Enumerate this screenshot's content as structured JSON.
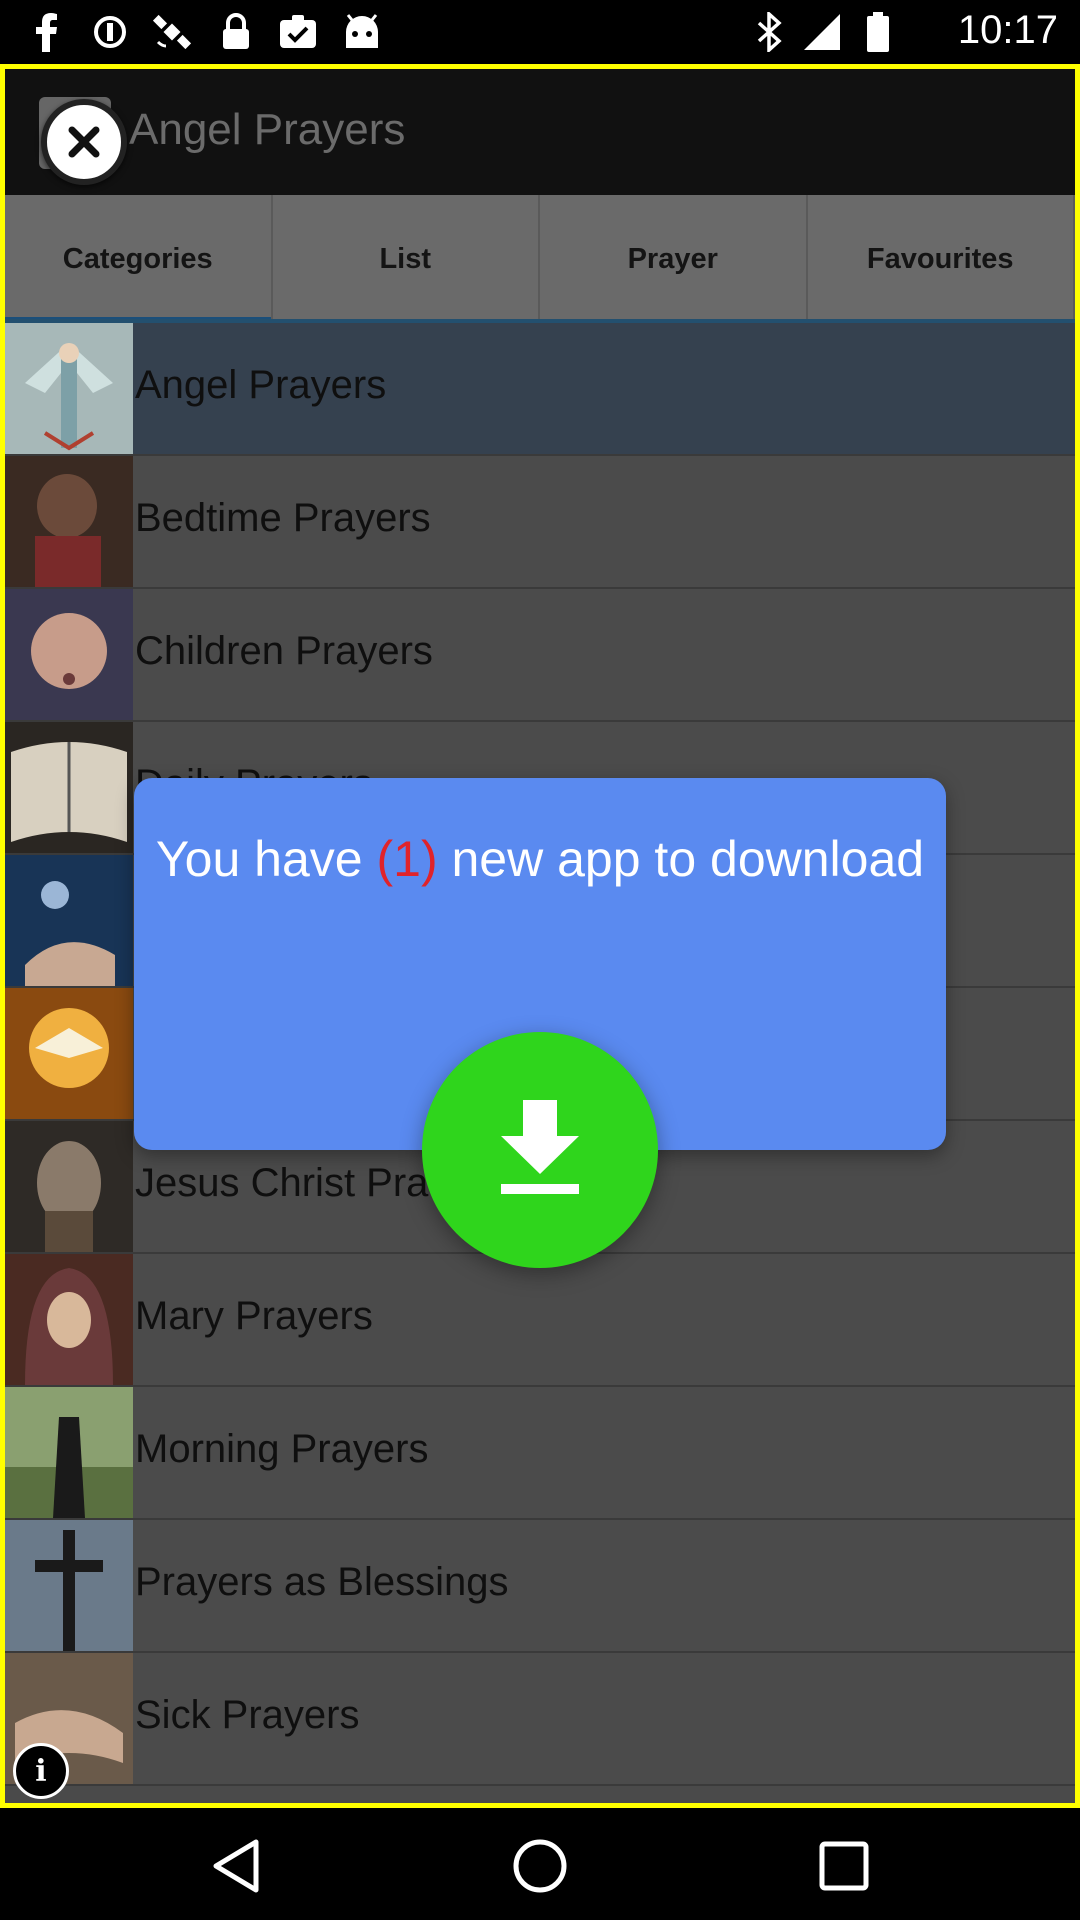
{
  "status_bar": {
    "time": "10:17",
    "left_icons": [
      "facebook-icon",
      "data-saver-icon",
      "fake-gps-icon",
      "lock-icon",
      "clipboard-check-icon",
      "android-icon"
    ],
    "right_icons": [
      "bluetooth-icon",
      "signal-icon",
      "battery-icon"
    ]
  },
  "app": {
    "title": "Angel Prayers"
  },
  "tabs": [
    {
      "label": "Categories",
      "active": true
    },
    {
      "label": "List",
      "active": false
    },
    {
      "label": "Prayer",
      "active": false
    },
    {
      "label": "Favourites",
      "active": false
    }
  ],
  "list": {
    "items": [
      {
        "label": "Angel Prayers",
        "selected": true
      },
      {
        "label": "Bedtime Prayers"
      },
      {
        "label": "Children Prayers"
      },
      {
        "label": "Daily Prayers"
      },
      {
        "label": ""
      },
      {
        "label": ""
      },
      {
        "label": "Jesus Christ Pra"
      },
      {
        "label": "Mary Prayers"
      },
      {
        "label": "Morning Prayers"
      },
      {
        "label": "Prayers as Blessings"
      },
      {
        "label": "Sick Prayers"
      }
    ]
  },
  "popup": {
    "text_before": "You have ",
    "count": "(1)",
    "text_after": " new app to download"
  },
  "colors": {
    "popup_bg": "#5a8af0",
    "download_button": "#2fd51c",
    "count_text": "#e0232a",
    "frame_border": "#ffff00",
    "selected_row": "#35414f"
  }
}
